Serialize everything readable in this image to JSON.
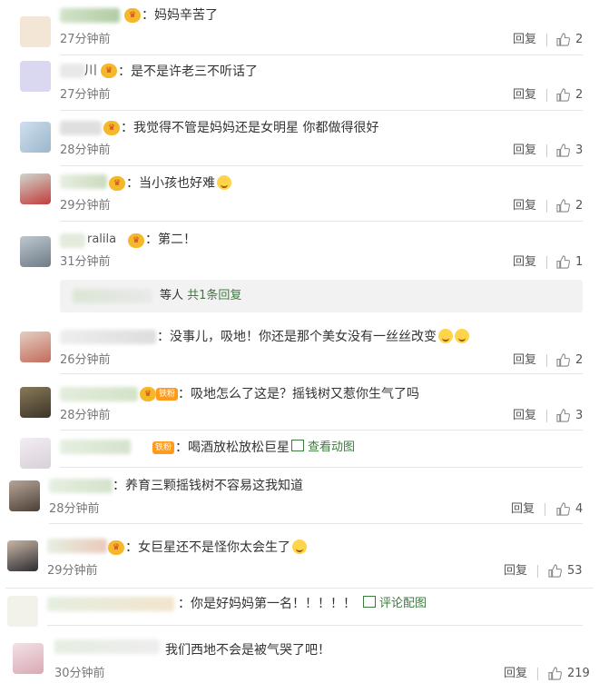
{
  "reply_label": "回复",
  "comments": [
    {
      "text": "：妈妈辛苦了",
      "time": "27分钟前",
      "likes": "2"
    },
    {
      "name_suffix": "川",
      "text": "：是不是许老三不听话了",
      "time": "27分钟前",
      "likes": "2"
    },
    {
      "text": "：我觉得不管是妈妈还是女明星 你都做得很好",
      "time": "28分钟前",
      "likes": "3"
    },
    {
      "text": "：当小孩也好难",
      "time": "29分钟前",
      "likes": "2"
    },
    {
      "name_suffix": "ralila",
      "text": "：第二！",
      "time": "31分钟前",
      "likes": "1"
    },
    {
      "text": "：没事儿，吸地！你还是那个美女没有一丝丝改变",
      "time": "26分钟前",
      "likes": "2"
    },
    {
      "fan_label": "铁粉",
      "text": "：吸地怎么了这是？摇钱树又惹你生气了吗",
      "time": "28分钟前",
      "likes": "3"
    },
    {
      "fan_label": "铁粉",
      "text": "：喝酒放松放松巨星",
      "link": "查看动图"
    },
    {
      "text": "：养育三颗摇钱树不容易这我知道",
      "time": "28分钟前",
      "likes": "4"
    },
    {
      "text": "：女巨星还不是怪你太会生了",
      "time": "29分钟前",
      "likes": "53"
    },
    {
      "text": "：你是好妈妈第一名！！！！！",
      "link": "评论配图"
    },
    {
      "text": "我们西地不会是被气哭了吧！",
      "time": "30分钟前",
      "likes": "219"
    }
  ],
  "more_replies": {
    "prefix": "等人",
    "link": "共1条回复"
  },
  "colors": {
    "link": "#3d7a3d",
    "badge": "#f5b82a",
    "fan": "#ff9a1c"
  }
}
